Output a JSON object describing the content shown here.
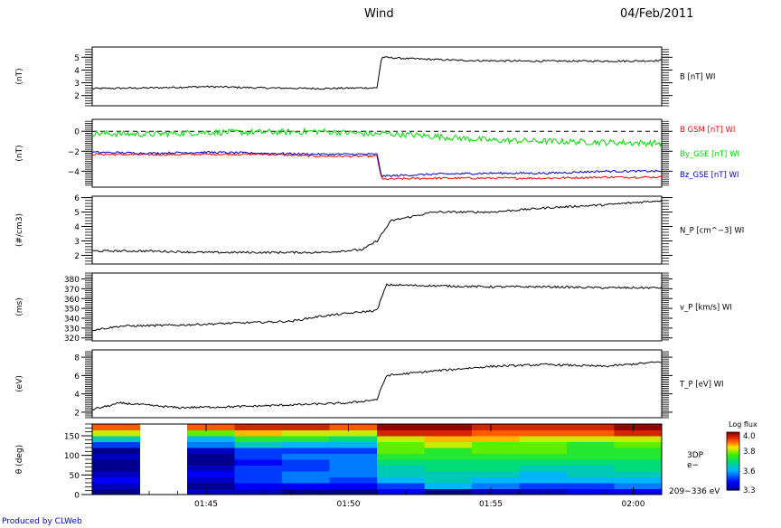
{
  "header": {
    "mission": "Wind",
    "date": "04/Feb/2011"
  },
  "footer": {
    "credit": "Produced by CLWeb"
  },
  "colors": {
    "black": "#000000",
    "bx": "#ff0000",
    "by": "#00dd00",
    "bz": "#0000cc"
  },
  "chart_data": [
    {
      "type": "line",
      "ylabel": "(nT)",
      "ylim": [
        1.2,
        5.8
      ],
      "yticks": [
        2,
        3,
        4,
        5
      ],
      "zero_line": false,
      "x_range": [
        "01:41",
        "02:01"
      ],
      "series": [
        {
          "name": "B [nT] WI",
          "color": "#000000",
          "x": [
            "01:41",
            "01:43",
            "01:45",
            "01:47",
            "01:49",
            "01:50:30",
            "01:51:00",
            "01:51:10",
            "01:52",
            "01:54",
            "01:56",
            "01:58",
            "02:00",
            "02:01"
          ],
          "values": [
            2.55,
            2.6,
            2.7,
            2.6,
            2.55,
            2.6,
            2.6,
            5.0,
            4.9,
            4.75,
            4.7,
            4.7,
            4.7,
            4.75
          ]
        }
      ]
    },
    {
      "type": "line",
      "ylabel": "(nT)",
      "ylim": [
        -5.6,
        1.2
      ],
      "yticks": [
        0,
        -2,
        -4
      ],
      "tick_labels": [
        "0",
        "−2",
        "−4"
      ],
      "zero_line": true,
      "x_range": [
        "01:41",
        "02:01"
      ],
      "series": [
        {
          "name": "B GSM [nT] WI",
          "color": "#ff0000",
          "x": [
            "01:41",
            "01:43",
            "01:45",
            "01:47",
            "01:49",
            "01:51:00",
            "01:51:10",
            "01:53",
            "01:55",
            "01:57",
            "01:59",
            "02:01"
          ],
          "values": [
            -2.3,
            -2.35,
            -2.3,
            -2.3,
            -2.5,
            -2.5,
            -4.8,
            -4.7,
            -4.7,
            -4.7,
            -4.6,
            -4.6
          ]
        },
        {
          "name": "By_GSE [nT] WI",
          "color": "#00dd00",
          "x": [
            "01:41",
            "01:43",
            "01:45",
            "01:47",
            "01:49",
            "01:51:00",
            "01:51:10",
            "01:53",
            "01:55",
            "01:57",
            "01:59",
            "02:01"
          ],
          "values": [
            -0.2,
            -0.3,
            -0.1,
            -0.1,
            0.0,
            -0.3,
            -0.2,
            -0.5,
            -0.9,
            -1.0,
            -1.1,
            -1.2
          ]
        },
        {
          "name": "Bz_GSE [nT] WI",
          "color": "#0000cc",
          "x": [
            "01:41",
            "01:43",
            "01:45",
            "01:47",
            "01:49",
            "01:51:00",
            "01:51:10",
            "01:53",
            "01:55",
            "01:57",
            "01:59",
            "02:01"
          ],
          "values": [
            -2.1,
            -2.2,
            -2.1,
            -2.2,
            -2.3,
            -2.3,
            -4.5,
            -4.3,
            -4.2,
            -4.2,
            -4.0,
            -4.0
          ]
        }
      ]
    },
    {
      "type": "line",
      "ylabel": "(#/cm3)",
      "ylim": [
        1.4,
        6.1
      ],
      "yticks": [
        2,
        3,
        4,
        5,
        6
      ],
      "zero_line": false,
      "x_range": [
        "01:41",
        "02:01"
      ],
      "series": [
        {
          "name": "N_P [cm^−3] WI",
          "color": "#000000",
          "x": [
            "01:41",
            "01:43",
            "01:45",
            "01:47",
            "01:49",
            "01:50:30",
            "01:51",
            "01:51:30",
            "01:53",
            "01:55",
            "01:57",
            "01:59",
            "02:01"
          ],
          "values": [
            2.3,
            2.3,
            2.2,
            2.2,
            2.2,
            2.4,
            3.0,
            4.4,
            5.0,
            5.0,
            5.3,
            5.5,
            5.8
          ]
        }
      ]
    },
    {
      "type": "line",
      "ylabel": "(ms)",
      "ylim": [
        317,
        386
      ],
      "yticks": [
        320,
        330,
        340,
        350,
        360,
        370,
        380
      ],
      "zero_line": false,
      "x_range": [
        "01:41",
        "02:01"
      ],
      "series": [
        {
          "name": "v_P [km/s] WI",
          "color": "#000000",
          "x": [
            "01:41",
            "01:42",
            "01:44",
            "01:46",
            "01:48",
            "01:49",
            "01:50",
            "01:51",
            "01:51:20",
            "01:53",
            "01:55",
            "01:57",
            "01:59",
            "02:01"
          ],
          "values": [
            328,
            332,
            333,
            335,
            337,
            342,
            345,
            348,
            374,
            373,
            372,
            372,
            371,
            371
          ]
        }
      ]
    },
    {
      "type": "line",
      "ylabel": "(eV)",
      "ylim": [
        1.4,
        8.8
      ],
      "yticks": [
        2,
        4,
        6,
        8
      ],
      "zero_line": false,
      "x_range": [
        "01:41",
        "02:01"
      ],
      "series": [
        {
          "name": "T_P [eV] WI",
          "color": "#000000",
          "x": [
            "01:41",
            "01:42",
            "01:44",
            "01:46",
            "01:48",
            "01:50",
            "01:51",
            "01:51:20",
            "01:53",
            "01:55",
            "01:57",
            "01:59",
            "02:01"
          ],
          "values": [
            2.3,
            3.0,
            2.5,
            2.6,
            2.8,
            3.0,
            3.4,
            6.0,
            6.5,
            7.0,
            7.2,
            7.0,
            7.5
          ]
        }
      ]
    },
    {
      "type": "heatmap",
      "ylabel": "θ (deg)",
      "ylim": [
        0,
        180
      ],
      "yticks": [
        0,
        50,
        100,
        150
      ],
      "x_range": [
        "01:41",
        "02:01"
      ],
      "xticks": [
        "01:45",
        "01:50",
        "01:55",
        "02:00"
      ],
      "instrument": "3DP",
      "species": "e−",
      "energy_range": "209−336 eV",
      "colorbar": {
        "title": "Log flux",
        "ticks": [
          "4.0",
          "3.8",
          "3.6",
          "3.3"
        ],
        "min": 3.3,
        "max": 4.0
      },
      "time_bins": [
        "01:41:00",
        "01:42:40",
        "01:44:20",
        "01:46:00",
        "01:47:40",
        "01:49:20",
        "01:51:00",
        "01:52:40",
        "01:54:20",
        "01:56:00",
        "01:57:40",
        "01:59:20"
      ],
      "theta_bins": [
        0,
        15,
        30,
        45,
        60,
        75,
        90,
        105,
        120,
        135,
        150,
        165,
        180
      ],
      "gap_bins": [
        1
      ],
      "values": [
        [
          3.3,
          3.3,
          3.35,
          3.35,
          3.3,
          3.3,
          3.4,
          3.3,
          3.35,
          3.35,
          3.4,
          3.4
        ],
        [
          3.35,
          3.35,
          3.3,
          3.4,
          3.4,
          3.4,
          3.45,
          3.55,
          3.5,
          3.45,
          3.45,
          3.5
        ],
        [
          3.4,
          3.4,
          3.35,
          3.45,
          3.5,
          3.45,
          3.55,
          3.6,
          3.55,
          3.55,
          3.55,
          3.55
        ],
        [
          3.35,
          3.35,
          3.4,
          3.45,
          3.5,
          3.5,
          3.6,
          3.6,
          3.6,
          3.55,
          3.6,
          3.6
        ],
        [
          3.3,
          3.3,
          3.35,
          3.45,
          3.45,
          3.5,
          3.6,
          3.65,
          3.65,
          3.6,
          3.6,
          3.65
        ],
        [
          3.3,
          3.3,
          3.3,
          3.4,
          3.45,
          3.5,
          3.65,
          3.65,
          3.65,
          3.65,
          3.65,
          3.65
        ],
        [
          3.35,
          3.35,
          3.3,
          3.45,
          3.5,
          3.5,
          3.7,
          3.7,
          3.7,
          3.7,
          3.7,
          3.7
        ],
        [
          3.3,
          3.3,
          3.35,
          3.45,
          3.45,
          3.45,
          3.75,
          3.7,
          3.75,
          3.75,
          3.7,
          3.7
        ],
        [
          3.45,
          3.45,
          3.5,
          3.6,
          3.55,
          3.55,
          3.75,
          3.8,
          3.75,
          3.75,
          3.7,
          3.75
        ],
        [
          3.6,
          3.6,
          3.55,
          3.7,
          3.7,
          3.65,
          3.8,
          3.85,
          3.85,
          3.8,
          3.8,
          3.8
        ],
        [
          3.8,
          3.8,
          3.75,
          3.85,
          3.8,
          3.8,
          3.95,
          3.95,
          3.9,
          3.9,
          3.9,
          3.95
        ],
        [
          3.9,
          3.9,
          3.9,
          3.95,
          3.95,
          3.9,
          4.0,
          4.0,
          3.95,
          3.95,
          3.95,
          4.0
        ]
      ]
    }
  ]
}
